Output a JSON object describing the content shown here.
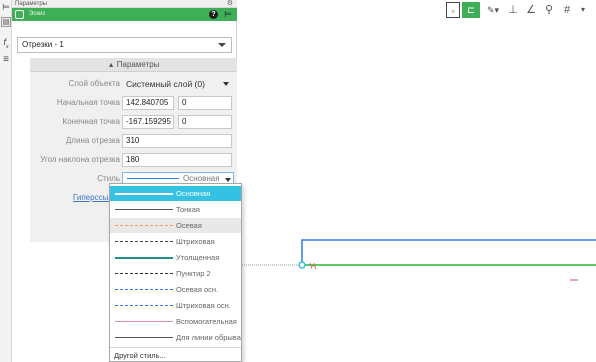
{
  "panel": {
    "title": "Параметры",
    "object_name": "Эскиз",
    "help_glyph": "?",
    "object_selector": "Отрезки - 1",
    "params_header": "Параметры",
    "fields": {
      "layer_label": "Слой объекта",
      "layer_value": "Системный слой (0)",
      "start_label": "Начальная точка",
      "start_x": "142.840705",
      "start_y": "0",
      "end_label": "Конечная точка",
      "end_x": "-167.159295",
      "end_y": "0",
      "length_label": "Длина отрезка",
      "length_value": "310",
      "angle_label": "Угол наклона отрезка",
      "angle_value": "180",
      "style_label": "Стиль",
      "style_value": "Основная",
      "hyperlink_label": "Гиперссылка"
    }
  },
  "style_options": [
    {
      "name": "Основная",
      "line": "solid-thick-blue",
      "selected": true
    },
    {
      "name": "Тонкая",
      "line": "solid-thin"
    },
    {
      "name": "Осевая",
      "line": "dash-dot-orange",
      "hovered": true
    },
    {
      "name": "Штриховая",
      "line": "dashed"
    },
    {
      "name": "Утолщенная",
      "line": "solid-thick-teal"
    },
    {
      "name": "Пунктир 2",
      "line": "dash-dot"
    },
    {
      "name": "Осевая осн.",
      "line": "dash-dot-blue"
    },
    {
      "name": "Штриховая осн.",
      "line": "dashed-blue"
    },
    {
      "name": "Вспомогательная",
      "line": "solid-thin-pink"
    },
    {
      "name": "Для линии обрыва",
      "line": "solid-thin"
    }
  ],
  "other_style": "Другой стиль...",
  "colors": {
    "accent_green": "#3eae57",
    "selection_blue": "#33c2e4",
    "sketch_blue": "#2f7fe0",
    "segment_green": "#22bb33",
    "link_blue": "#3c74c4"
  },
  "icons": [
    "tree-icon",
    "fx-icon",
    "menu-icon",
    "gear-icon",
    "help-icon",
    "sketch-icon",
    "chevron-down-icon",
    "toolbar-icons"
  ]
}
